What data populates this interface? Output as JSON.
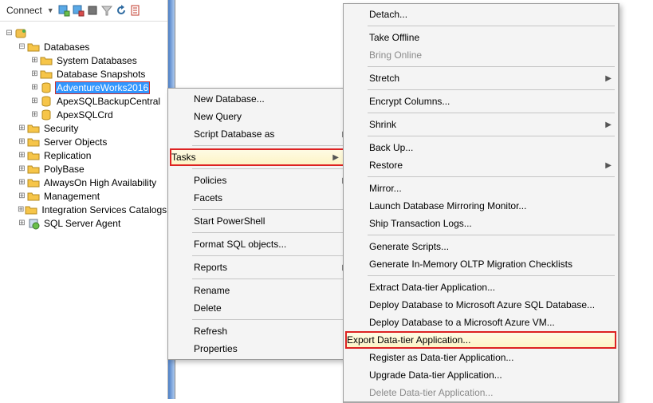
{
  "toolbar": {
    "connect_label": "Connect"
  },
  "tree": {
    "databases": "Databases",
    "system_dbs": "System Databases",
    "db_snapshots": "Database Snapshots",
    "adventureworks": "AdventureWorks2016",
    "apex_backup": "ApexSQLBackupCentral",
    "apex_crd": "ApexSQLCrd",
    "security": "Security",
    "server_objects": "Server Objects",
    "replication": "Replication",
    "polybase": "PolyBase",
    "alwayson": "AlwaysOn High Availability",
    "management": "Management",
    "integration": "Integration Services Catalogs",
    "sql_agent": "SQL Server Agent"
  },
  "menu1": {
    "new_database": "New Database...",
    "new_query": "New Query",
    "script_db": "Script Database as",
    "tasks": "Tasks",
    "policies": "Policies",
    "facets": "Facets",
    "start_powershell": "Start PowerShell",
    "format_sql": "Format SQL objects...",
    "reports": "Reports",
    "rename": "Rename",
    "delete": "Delete",
    "refresh": "Refresh",
    "properties": "Properties"
  },
  "menu2": {
    "detach": "Detach...",
    "take_offline": "Take Offline",
    "bring_online": "Bring Online",
    "stretch": "Stretch",
    "encrypt": "Encrypt Columns...",
    "shrink": "Shrink",
    "back_up": "Back Up...",
    "restore": "Restore",
    "mirror": "Mirror...",
    "launch_mirror": "Launch Database Mirroring Monitor...",
    "ship_logs": "Ship Transaction Logs...",
    "gen_scripts": "Generate Scripts...",
    "gen_oltp": "Generate In-Memory OLTP Migration Checklists",
    "extract_dac": "Extract Data-tier Application...",
    "deploy_azure_db": "Deploy Database to Microsoft Azure SQL Database...",
    "deploy_azure_vm": "Deploy Database to a Microsoft Azure VM...",
    "export_dac": "Export Data-tier Application...",
    "register_dac": "Register as Data-tier Application...",
    "upgrade_dac": "Upgrade Data-tier Application...",
    "delete_dac": "Delete Data-tier Application..."
  }
}
